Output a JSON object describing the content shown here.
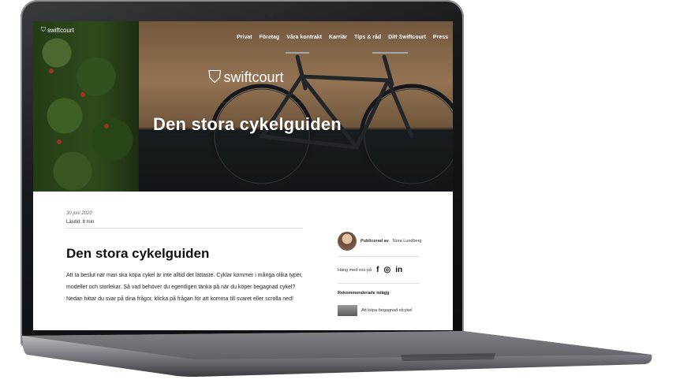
{
  "nav": {
    "logo": "swiftcourt",
    "items": [
      "Privat",
      "Företag",
      "Våra kontrakt",
      "Karriär",
      "Tips & råd",
      "Ditt Swiftcourt",
      "Press"
    ]
  },
  "hero": {
    "logo": "swiftcourt",
    "title": "Den stora cykelguiden"
  },
  "article": {
    "date": "30 juni 2020",
    "read_time": "Läsitid: 8 min",
    "title": "Den stora cykelguiden",
    "body": "Att ta beslut när man ska köpa cykel är inte alltid det lättaste. Cyklar kommer i många olika typer, modeller och storlekar. Så vad behöver du egentligen tänka på när du köper begagnad cykel? Nedan hittar du svar på dina frågor, klicka på frågan för att komma till svaret eller scrolla ned!"
  },
  "sidebar": {
    "published_by": "Publicerad av",
    "author": "Nora Lundberg",
    "follow_label": "Häng med oss på",
    "social": [
      "f",
      "◎",
      "in"
    ],
    "recommended_heading": "Rekommenderade inlägg",
    "recommended": [
      {
        "title": "Att köpa begagnad elcykel"
      }
    ]
  }
}
